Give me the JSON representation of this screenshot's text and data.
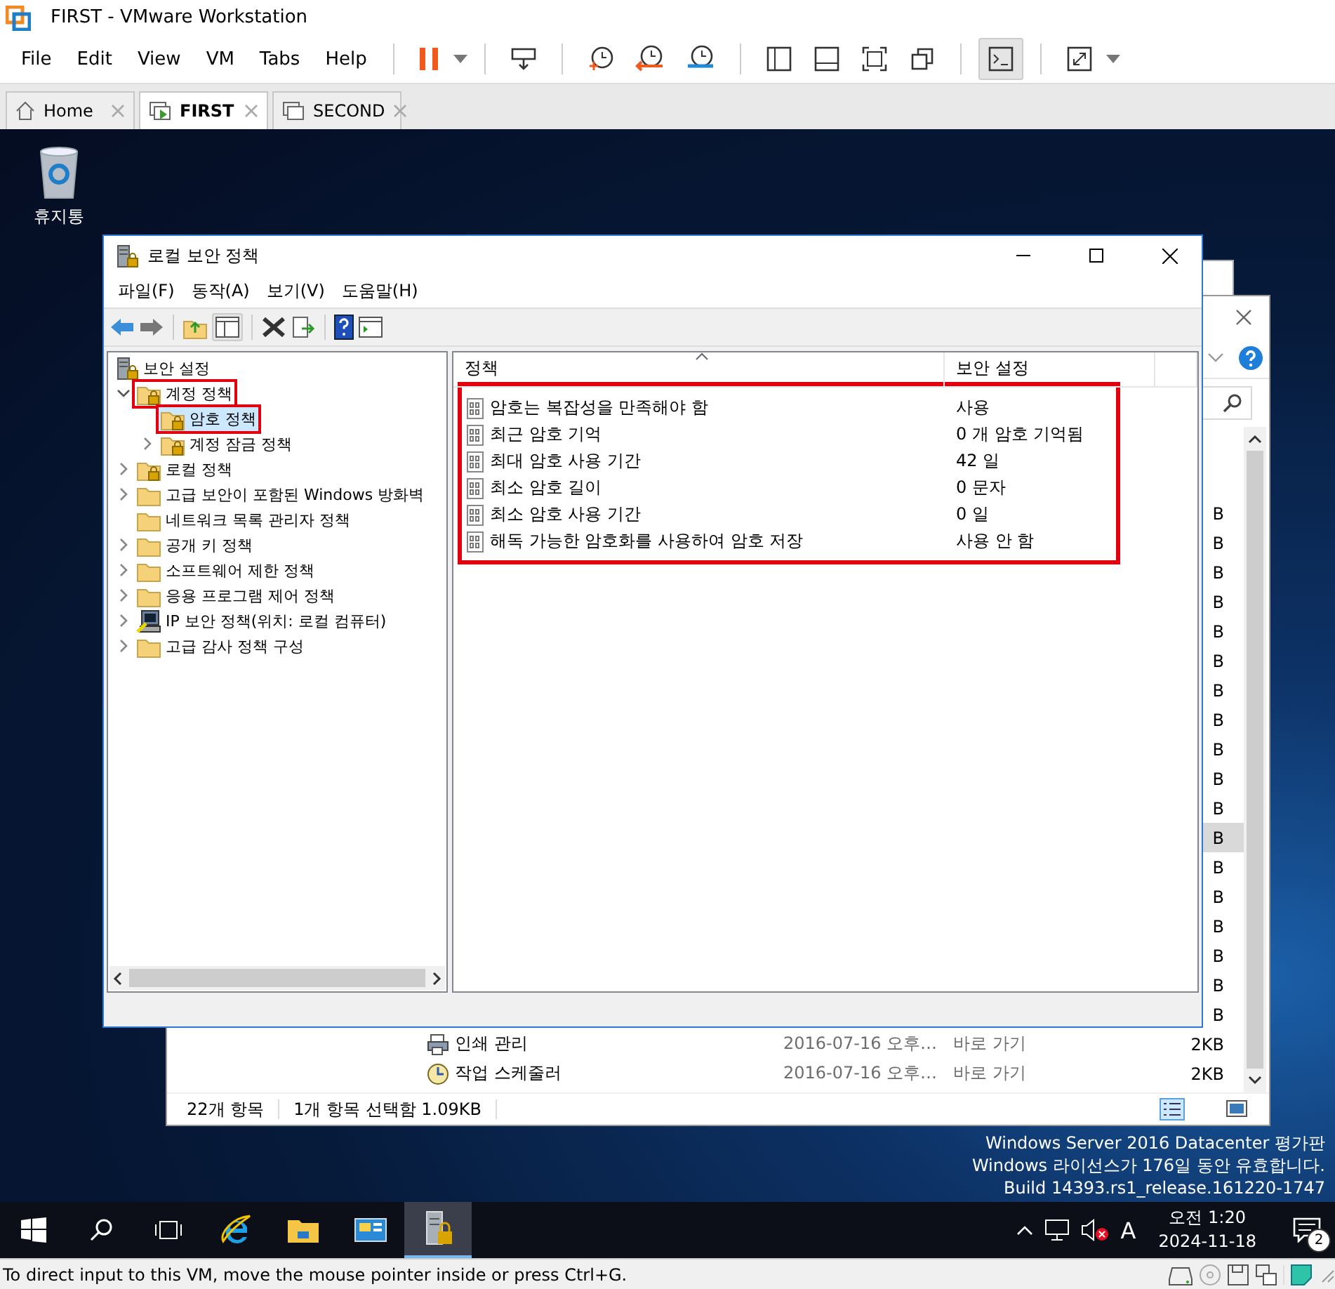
{
  "vmware": {
    "title": "FIRST - VMware Workstation",
    "menu": [
      "File",
      "Edit",
      "View",
      "VM",
      "Tabs",
      "Help"
    ],
    "tabs": [
      {
        "label": "Home",
        "kind": "home",
        "selected": false
      },
      {
        "label": "FIRST",
        "kind": "vm",
        "selected": true
      },
      {
        "label": "SECOND",
        "kind": "vm",
        "selected": false
      }
    ],
    "status_text": "To direct input to this VM, move the mouse pointer inside or press Ctrl+G."
  },
  "desktop": {
    "icons": [
      {
        "label": "휴지통"
      }
    ],
    "watermark": [
      "Windows Server 2016 Datacenter 평가판",
      "Windows 라이선스가 176일 동안 유효합니다.",
      "Build 14393.rs1_release.161220-1747"
    ]
  },
  "explorer": {
    "covered_rows": [
      {
        "size": "B",
        "selected": false
      },
      {
        "size": "B",
        "selected": false
      },
      {
        "size": "B",
        "selected": false
      },
      {
        "size": "B",
        "selected": false
      },
      {
        "size": "B",
        "selected": false
      },
      {
        "size": "B",
        "selected": false
      },
      {
        "size": "B",
        "selected": false
      },
      {
        "size": "B",
        "selected": false
      },
      {
        "size": "B",
        "selected": false
      },
      {
        "size": "B",
        "selected": false
      },
      {
        "size": "B",
        "selected": false
      },
      {
        "size": "B",
        "selected": true
      },
      {
        "size": "B",
        "selected": false
      },
      {
        "size": "B",
        "selected": false
      },
      {
        "size": "B",
        "selected": false
      },
      {
        "size": "B",
        "selected": false
      },
      {
        "size": "B",
        "selected": false
      },
      {
        "size": "B",
        "selected": false
      }
    ],
    "rows": [
      {
        "kind": "print",
        "name": "인쇄 관리",
        "date": "2016-07-16 오후…",
        "type": "바로 가기",
        "size": "2KB",
        "selected": false
      },
      {
        "kind": "clock",
        "name": "작업 스케줄러",
        "date": "2016-07-16 오후…",
        "type": "바로 가기",
        "size": "2KB",
        "selected": false
      }
    ],
    "status": {
      "count": "22개 항목",
      "selection": "1개 항목 선택함 1.09KB"
    }
  },
  "mmc": {
    "title": "로컬 보안 정책",
    "menu": [
      "파일(F)",
      "동작(A)",
      "보기(V)",
      "도움말(H)"
    ],
    "tree": {
      "root": "보안 설정",
      "items": [
        {
          "label": "계정 정책",
          "kind": "secured",
          "expandable": true,
          "expanded": true,
          "selected": false,
          "boxed": true,
          "children": [
            {
              "label": "암호 정책",
              "kind": "secured",
              "expandable": false,
              "selected": true,
              "boxed": true
            },
            {
              "label": "계정 잠금 정책",
              "kind": "secured",
              "expandable": true,
              "expanded": false,
              "selected": false,
              "boxed": false
            }
          ]
        },
        {
          "label": "로컬 정책",
          "kind": "secured",
          "expandable": true,
          "expanded": false,
          "selected": false,
          "boxed": false
        },
        {
          "label": "고급 보안이 포함된 Windows 방화벽",
          "kind": "plain",
          "expandable": true,
          "expanded": false,
          "selected": false,
          "boxed": false
        },
        {
          "label": "네트워크 목록 관리자 정책",
          "kind": "plain",
          "expandable": false,
          "selected": false,
          "boxed": false
        },
        {
          "label": "공개 키 정책",
          "kind": "plain",
          "expandable": true,
          "expanded": false,
          "selected": false,
          "boxed": false
        },
        {
          "label": "소프트웨어 제한 정책",
          "kind": "plain",
          "expandable": true,
          "expanded": false,
          "selected": false,
          "boxed": false
        },
        {
          "label": "응용 프로그램 제어 정책",
          "kind": "plain",
          "expandable": true,
          "expanded": false,
          "selected": false,
          "boxed": false
        },
        {
          "label": "IP 보안 정책(위치: 로컬 컴퓨터)",
          "kind": "ip",
          "expandable": true,
          "expanded": false,
          "selected": false,
          "boxed": false
        },
        {
          "label": "고급 감사 정책 구성",
          "kind": "plain",
          "expandable": true,
          "expanded": false,
          "selected": false,
          "boxed": false
        }
      ]
    },
    "columns": [
      "정책",
      "보안 설정"
    ],
    "rows_boxed": true,
    "rows": [
      {
        "policy": "암호는 복잡성을 만족해야 함",
        "setting": "사용"
      },
      {
        "policy": "최근 암호 기억",
        "setting": "0 개 암호 기억됨"
      },
      {
        "policy": "최대 암호 사용 기간",
        "setting": "42 일"
      },
      {
        "policy": "최소 암호 길이",
        "setting": "0 문자"
      },
      {
        "policy": "최소 암호 사용 기간",
        "setting": "0 일"
      },
      {
        "policy": "해독 가능한 암호화를 사용하여 암호 저장",
        "setting": "사용 안 함"
      }
    ]
  },
  "taskbar": {
    "apps": [
      {
        "kind": "start",
        "selected": false
      },
      {
        "kind": "search",
        "selected": false
      },
      {
        "kind": "taskview",
        "selected": false
      },
      {
        "kind": "ie",
        "selected": false
      },
      {
        "kind": "explorer",
        "selected": false
      },
      {
        "kind": "servermanager",
        "selected": false
      },
      {
        "kind": "mmc",
        "selected": true
      }
    ],
    "ime": "A",
    "time": "오전 1:20",
    "date": "2024-11-18",
    "notifications": "2"
  }
}
